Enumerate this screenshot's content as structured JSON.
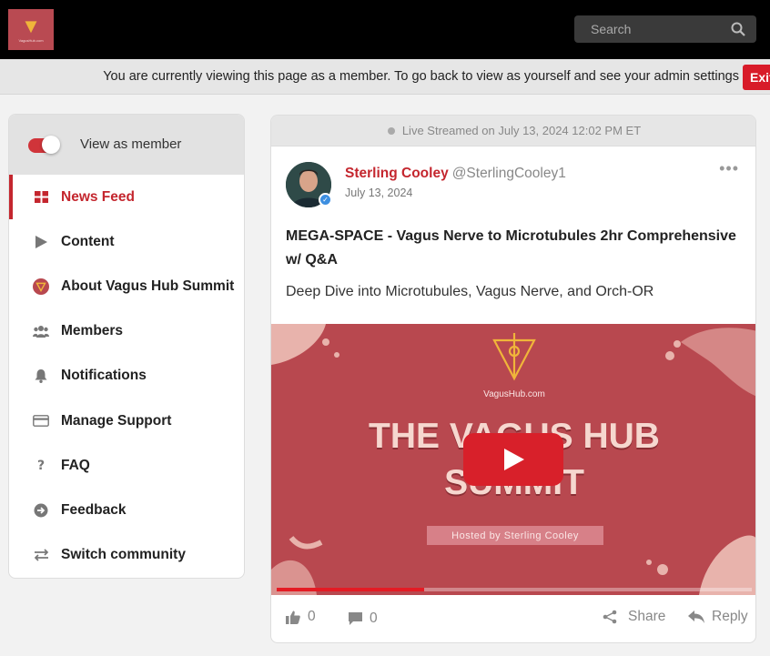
{
  "header": {
    "logo_text": "VagusHub.com",
    "search": {
      "placeholder": "Search"
    }
  },
  "member_bar": {
    "message": "You are currently viewing this page as a member. To go back to view as yourself and see your admin settings",
    "exit_label": "Exit"
  },
  "sidebar": {
    "view_as_label": "View as member",
    "view_as_on": true,
    "items": [
      {
        "label": "News Feed",
        "icon": "grid-icon",
        "active": true
      },
      {
        "label": "Content",
        "icon": "play-icon"
      },
      {
        "label": "About Vagus Hub Summit",
        "icon": "community-logo-icon"
      },
      {
        "label": "Members",
        "icon": "people-icon"
      },
      {
        "label": "Notifications",
        "icon": "bell-icon"
      },
      {
        "label": "Manage Support",
        "icon": "credit-card-icon"
      },
      {
        "label": "FAQ",
        "icon": "question-icon"
      },
      {
        "label": "Feedback",
        "icon": "arrow-circle-icon"
      },
      {
        "label": "Switch community",
        "icon": "swap-icon"
      }
    ]
  },
  "post": {
    "live_label": "Live Streamed on July 13, 2024 12:02 PM ET",
    "author_name": "Sterling Cooley",
    "author_handle": "@SterlingCooley1",
    "date": "July 13, 2024",
    "title": "MEGA-SPACE - Vagus Nerve to Microtubules 2hr Comprehensive w/ Q&A",
    "description": "Deep Dive into Microtubules, Vagus Nerve, and Orch-OR",
    "video": {
      "brand": "VagusHub.com",
      "title_line1": "THE VAGUS HUB",
      "title_line2": "SUMMIT",
      "hosted_by": "Hosted by Sterling Cooley",
      "progress": 0.31
    },
    "likes": "0",
    "comments": "0",
    "share_label": "Share",
    "reply_label": "Reply"
  },
  "colors": {
    "accent": "#c4262e",
    "video_bg": "#b8484f",
    "youtube_red": "#d8202a"
  }
}
